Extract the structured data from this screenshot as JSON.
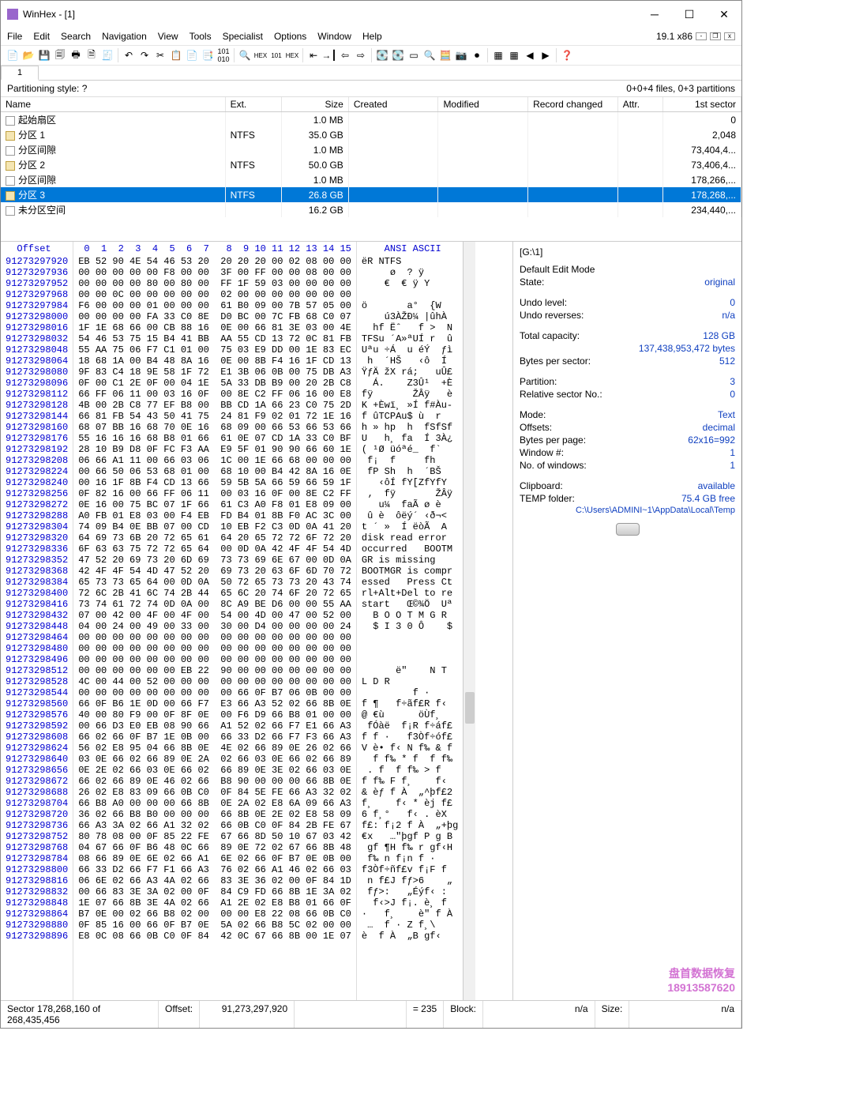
{
  "window": {
    "title": "WinHex - [1]",
    "version_label": "19.1 x86"
  },
  "menu": {
    "items": [
      "File",
      "Edit",
      "Search",
      "Navigation",
      "View",
      "Tools",
      "Specialist",
      "Options",
      "Window",
      "Help"
    ]
  },
  "tab_label": "1",
  "infobar": {
    "left": "Partitioning style: ?",
    "right": "0+0+4 files, 0+3 partitions"
  },
  "columns": [
    "Name",
    "Ext.",
    "Size",
    "Created",
    "Modified",
    "Record changed",
    "Attr.",
    "1st sector"
  ],
  "rows": [
    {
      "name": "起始扇区",
      "ext": "",
      "size": "1.0 MB",
      "first": "0",
      "icon": "plain"
    },
    {
      "name": "分区 1",
      "ext": "NTFS",
      "size": "35.0 GB",
      "first": "2,048",
      "icon": "part"
    },
    {
      "name": "分区间隙",
      "ext": "",
      "size": "1.0 MB",
      "first": "73,404,4...",
      "icon": "plain"
    },
    {
      "name": "分区 2",
      "ext": "NTFS",
      "size": "50.0 GB",
      "first": "73,406,4...",
      "icon": "part"
    },
    {
      "name": "分区间隙",
      "ext": "",
      "size": "1.0 MB",
      "first": "178,266,...",
      "icon": "plain"
    },
    {
      "name": "分区 3",
      "ext": "NTFS",
      "size": "26.8 GB",
      "first": "178,268,...",
      "icon": "part",
      "selected": true
    },
    {
      "name": "未分区空间",
      "ext": "",
      "size": "16.2 GB",
      "first": "234,440,...",
      "icon": "plain"
    }
  ],
  "hex": {
    "header_offset": "Offset",
    "byte_headers": " 0  1  2  3  4  5  6  7   8  9 10 11 12 13 14 15",
    "ascii_header": "    ANSI ASCII",
    "lines": [
      {
        "off": "91273297920",
        "b": "EB 52 90 4E 54 46 53 20  20 20 20 00 02 08 00 00",
        "a": "ëR NTFS         "
      },
      {
        "off": "91273297936",
        "b": "00 00 00 00 00 F8 00 00  3F 00 FF 00 00 08 00 00",
        "a": "     ø  ? ÿ     "
      },
      {
        "off": "91273297952",
        "b": "00 00 00 00 80 00 80 00  FF 1F 59 03 00 00 00 00",
        "a": "    €  € ÿ Y    "
      },
      {
        "off": "91273297968",
        "b": "00 00 0C 00 00 00 00 00  02 00 00 00 00 00 00 00",
        "a": "                "
      },
      {
        "off": "91273297984",
        "b": "F6 00 00 00 01 00 00 00  61 B0 09 00 7B 57 05 00",
        "a": "ö       a°  {W  "
      },
      {
        "off": "91273298000",
        "b": "00 00 00 00 FA 33 C0 8E  D0 BC 00 7C FB 68 C0 07",
        "a": "    ú3ÀŽÐ¼ |ûhÀ "
      },
      {
        "off": "91273298016",
        "b": "1F 1E 68 66 00 CB 88 16  0E 00 66 81 3E 03 00 4E",
        "a": "  hf Ëˆ   f >  N"
      },
      {
        "off": "91273298032",
        "b": "54 46 53 75 15 B4 41 BB  AA 55 CD 13 72 0C 81 FB",
        "a": "TFSu ´A»ªUÍ r  û"
      },
      {
        "off": "91273298048",
        "b": "55 AA 75 06 F7 C1 01 00  75 03 E9 DD 00 1E 83 EC",
        "a": "Uªu ÷Á  u éÝ  ƒì"
      },
      {
        "off": "91273298064",
        "b": "18 68 1A 00 B4 48 8A 16  0E 00 8B F4 16 1F CD 13",
        "a": " h  ´HŠ   ‹ô  Í "
      },
      {
        "off": "91273298080",
        "b": "9F 83 C4 18 9E 58 1F 72  E1 3B 06 0B 00 75 DB A3",
        "a": "ŸƒÄ žX rá;   uÛ£"
      },
      {
        "off": "91273298096",
        "b": "0F 00 C1 2E 0F 00 04 1E  5A 33 DB B9 00 20 2B C8",
        "a": "  Á.    Z3Û¹  +È"
      },
      {
        "off": "91273298112",
        "b": "66 FF 06 11 00 03 16 0F  00 8E C2 FF 06 16 00 E8",
        "a": "fÿ       ŽÂÿ   è"
      },
      {
        "off": "91273298128",
        "b": "4B 00 2B C8 77 EF B8 00  BB CD 1A 66 23 C0 75 2D",
        "a": "K +Èwï¸ »Í f#Àu-"
      },
      {
        "off": "91273298144",
        "b": "66 81 FB 54 43 50 41 75  24 81 F9 02 01 72 1E 16",
        "a": "f ûTCPAu$ ù  r  "
      },
      {
        "off": "91273298160",
        "b": "68 07 BB 16 68 70 0E 16  68 09 00 66 53 66 53 66",
        "a": "h » hp  h  fSfSf"
      },
      {
        "off": "91273298176",
        "b": "55 16 16 16 68 B8 01 66  61 0E 07 CD 1A 33 C0 BF",
        "a": "U   h¸ fa  Í 3À¿"
      },
      {
        "off": "91273298192",
        "b": "28 10 B9 D8 0F FC F3 AA  E9 5F 01 90 90 66 60 1E",
        "a": "( ¹Ø üóªé_  f` "
      },
      {
        "off": "91273298208",
        "b": "06 66 A1 11 00 66 03 06  1C 00 1E 66 68 00 00 00",
        "a": " f¡  f     fh   "
      },
      {
        "off": "91273298224",
        "b": "00 66 50 06 53 68 01 00  68 10 00 B4 42 8A 16 0E",
        "a": " fP Sh  h  ´BŠ  "
      },
      {
        "off": "91273298240",
        "b": "00 16 1F 8B F4 CD 13 66  59 5B 5A 66 59 66 59 1F",
        "a": "   ‹ôÍ fY[ZfYfY "
      },
      {
        "off": "91273298256",
        "b": "0F 82 16 00 66 FF 06 11  00 03 16 0F 00 8E C2 FF",
        "a": " ‚  fÿ       ŽÂÿ"
      },
      {
        "off": "91273298272",
        "b": "0E 16 00 75 BC 07 1F 66  61 C3 A0 F8 01 E8 09 00",
        "a": "   u¼  faÃ ø è  "
      },
      {
        "off": "91273298288",
        "b": "A0 FB 01 E8 03 00 F4 EB  FD B4 01 8B F0 AC 3C 00",
        "a": " û è  ôëý´ ‹ð¬< "
      },
      {
        "off": "91273298304",
        "b": "74 09 B4 0E BB 07 00 CD  10 EB F2 C3 0D 0A 41 20",
        "a": "t ´ »  Í ëòÃ  A "
      },
      {
        "off": "91273298320",
        "b": "64 69 73 6B 20 72 65 61  64 20 65 72 72 6F 72 20",
        "a": "disk read error "
      },
      {
        "off": "91273298336",
        "b": "6F 63 63 75 72 72 65 64  00 0D 0A 42 4F 4F 54 4D",
        "a": "occurred   BOOTM"
      },
      {
        "off": "91273298352",
        "b": "47 52 20 69 73 20 6D 69  73 73 69 6E 67 00 0D 0A",
        "a": "GR is missing   "
      },
      {
        "off": "91273298368",
        "b": "42 4F 4F 54 4D 47 52 20  69 73 20 63 6F 6D 70 72",
        "a": "BOOTMGR is compr"
      },
      {
        "off": "91273298384",
        "b": "65 73 73 65 64 00 0D 0A  50 72 65 73 73 20 43 74",
        "a": "essed   Press Ct"
      },
      {
        "off": "91273298400",
        "b": "72 6C 2B 41 6C 74 2B 44  65 6C 20 74 6F 20 72 65",
        "a": "rl+Alt+Del to re"
      },
      {
        "off": "91273298416",
        "b": "73 74 61 72 74 0D 0A 00  8C A9 BE D6 00 00 55 AA",
        "a": "start   Œ©¾Ö  Uª"
      },
      {
        "off": "91273298432",
        "b": "07 00 42 00 4F 00 4F 00  54 00 4D 00 47 00 52 00",
        "a": "  B O O T M G R "
      },
      {
        "off": "91273298448",
        "b": "04 00 24 00 49 00 33 00  30 00 D4 00 00 00 00 24",
        "a": "  $ I 3 0 Ô    $"
      },
      {
        "off": "91273298464",
        "b": "00 00 00 00 00 00 00 00  00 00 00 00 00 00 00 00",
        "a": "                "
      },
      {
        "off": "91273298480",
        "b": "00 00 00 00 00 00 00 00  00 00 00 00 00 00 00 00",
        "a": "                "
      },
      {
        "off": "91273298496",
        "b": "00 00 00 00 00 00 00 00  00 00 00 00 00 00 00 00",
        "a": "                "
      },
      {
        "off": "91273298512",
        "b": "00 00 00 00 00 00 EB 22  90 00 00 00 00 00 00 00",
        "a": "      ë\"    N T "
      },
      {
        "off": "91273298528",
        "b": "4C 00 44 00 52 00 00 00  00 00 00 00 00 00 00 00",
        "a": "L D R           "
      },
      {
        "off": "91273298544",
        "b": "00 00 00 00 00 00 00 00  00 66 0F B7 06 0B 00 00",
        "a": "         f ·    "
      },
      {
        "off": "91273298560",
        "b": "66 0F B6 1E 0D 00 66 F7  E3 66 A3 52 02 66 8B 0E",
        "a": "f ¶   f÷ãf£R f‹ "
      },
      {
        "off": "91273298576",
        "b": "40 00 80 F9 00 0F 8F 0E  00 F6 D9 66 B8 01 00 00",
        "a": "@ €ù      öÙf¸  "
      },
      {
        "off": "91273298592",
        "b": "00 66 D3 E0 EB 08 90 66  A1 52 02 66 F7 E1 66 A3",
        "a": " fÓàë  f¡R f÷áf£"
      },
      {
        "off": "91273298608",
        "b": "66 02 66 0F B7 1E 0B 00  66 33 D2 66 F7 F3 66 A3",
        "a": "f f ·   f3Òf÷óf£"
      },
      {
        "off": "91273298624",
        "b": "56 02 E8 95 04 66 8B 0E  4E 02 66 89 0E 26 02 66",
        "a": "V è• f‹ N f‰ & f"
      },
      {
        "off": "91273298640",
        "b": "03 0E 66 02 66 89 0E 2A  02 66 03 0E 66 02 66 89",
        "a": "  f f‰ * f  f f‰"
      },
      {
        "off": "91273298656",
        "b": "0E 2E 02 66 03 0E 66 02  66 89 0E 3E 02 66 03 0E",
        "a": " . f  f f‰ > f  "
      },
      {
        "off": "91273298672",
        "b": "66 02 66 89 0E 46 02 66  B8 90 00 00 00 66 8B 0E",
        "a": "f f‰ F f¸    f‹ "
      },
      {
        "off": "91273298688",
        "b": "26 02 E8 83 09 66 0B C0  0F 84 5E FE 66 A3 32 02",
        "a": "& èƒ f À  „^þf£2"
      },
      {
        "off": "91273298704",
        "b": "66 B8 A0 00 00 00 66 8B  0E 2A 02 E8 6A 09 66 A3",
        "a": "f¸    f‹ * èj f£"
      },
      {
        "off": "91273298720",
        "b": "36 02 66 B8 B0 00 00 00  66 8B 0E 2E 02 E8 58 09",
        "a": "6 f¸°   f‹ . èX "
      },
      {
        "off": "91273298736",
        "b": "66 A3 3A 02 66 A1 32 02  66 0B C0 0F 84 2B FE 67",
        "a": "f£: f¡2 f À  „+þg"
      },
      {
        "off": "91273298752",
        "b": "80 78 08 00 0F 85 22 FE  67 66 8D 50 10 67 03 42",
        "a": "€x   …\"þgf P g B"
      },
      {
        "off": "91273298768",
        "b": "04 67 66 0F B6 48 0C 66  89 0E 72 02 67 66 8B 48",
        "a": " gf ¶H f‰ r gf‹H"
      },
      {
        "off": "91273298784",
        "b": "08 66 89 0E 6E 02 66 A1  6E 02 66 0F B7 0E 0B 00",
        "a": " f‰ n f¡n f ·   "
      },
      {
        "off": "91273298800",
        "b": "66 33 D2 66 F7 F1 66 A3  76 02 66 A1 46 02 66 03",
        "a": "f3Òf÷ñf£v f¡F f "
      },
      {
        "off": "91273298816",
        "b": "06 6E 02 66 A3 4A 02 66  83 3E 36 02 00 0F 84 1D",
        "a": " n f£J fƒ>6    „"
      },
      {
        "off": "91273298832",
        "b": "00 66 83 3E 3A 02 00 0F  84 C9 FD 66 8B 1E 3A 02",
        "a": " fƒ>:   „Éýf‹ : "
      },
      {
        "off": "91273298848",
        "b": "1E 07 66 8B 3E 4A 02 66  A1 2E 02 E8 B8 01 66 0F",
        "a": "  f‹>J f¡. è¸ f "
      },
      {
        "off": "91273298864",
        "b": "B7 0E 00 02 66 B8 02 00  00 00 E8 22 08 66 0B C0",
        "a": "·   f¸    è\" f À"
      },
      {
        "off": "91273298880",
        "b": "0F 85 16 00 66 0F B7 0E  5A 02 66 B8 5C 02 00 00",
        "a": " …  f · Z f¸\\   "
      },
      {
        "off": "91273298896",
        "b": "E8 0C 08 66 0B C0 0F 84  42 0C 67 66 8B 00 1E 07",
        "a": "è  f À  „B gf‹  "
      }
    ]
  },
  "right_panel": {
    "path": "[G:\\1]",
    "edit_mode_label": "Default Edit Mode",
    "state_label": "State:",
    "state_value": "original",
    "undo_level_label": "Undo level:",
    "undo_level_value": "0",
    "undo_reverses_label": "Undo reverses:",
    "undo_reverses_value": "n/a",
    "total_capacity_label": "Total capacity:",
    "total_capacity_value": "128 GB",
    "total_capacity_bytes": "137,438,953,472 bytes",
    "bytes_per_sector_label": "Bytes per sector:",
    "bytes_per_sector_value": "512",
    "partition_label": "Partition:",
    "partition_value": "3",
    "rel_sector_label": "Relative sector No.:",
    "rel_sector_value": "0",
    "mode_label": "Mode:",
    "mode_value": "Text",
    "offsets_label": "Offsets:",
    "offsets_value": "decimal",
    "bpp_label": "Bytes per page:",
    "bpp_value": "62x16=992",
    "window_no_label": "Window #:",
    "window_no_value": "1",
    "no_windows_label": "No. of windows:",
    "no_windows_value": "1",
    "clipboard_label": "Clipboard:",
    "clipboard_value": "available",
    "temp_label": "TEMP folder:",
    "temp_value": "75.4 GB free",
    "temp_path": "C:\\Users\\ADMINI~1\\AppData\\Local\\Temp"
  },
  "watermark": {
    "line1": "盘首数据恢复",
    "line2": "18913587620"
  },
  "statusbar": {
    "sector_label": "Sector 178,268,160 of 268,435,456",
    "offset_label": "Offset:",
    "offset_value": "91,273,297,920",
    "eq_value": "= 235",
    "block_label": "Block:",
    "block_value": "n/a",
    "size_label": "Size:",
    "size_value": "n/a"
  }
}
